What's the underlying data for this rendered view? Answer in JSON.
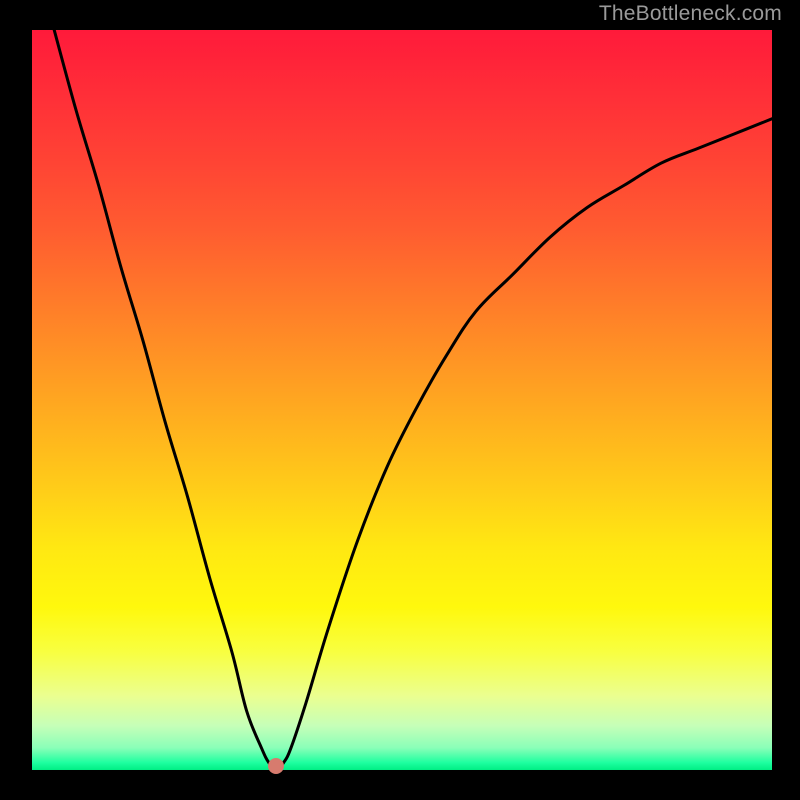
{
  "attribution": "TheBottleneck.com",
  "chart_data": {
    "type": "line",
    "title": "",
    "xlabel": "",
    "ylabel": "",
    "xlim": [
      0,
      100
    ],
    "ylim": [
      0,
      100
    ],
    "grid": false,
    "legend": false,
    "background": "gradient-red-to-green-vertical",
    "series": [
      {
        "name": "bottleneck-curve",
        "color": "#000000",
        "x": [
          3,
          6,
          9,
          12,
          15,
          18,
          21,
          24,
          27,
          29,
          31,
          32,
          33,
          34,
          35,
          37,
          40,
          44,
          48,
          52,
          56,
          60,
          65,
          70,
          75,
          80,
          85,
          90,
          95,
          100
        ],
        "y": [
          100,
          89,
          79,
          68,
          58,
          47,
          37,
          26,
          16,
          8,
          3,
          1,
          0,
          1,
          3,
          9,
          19,
          31,
          41,
          49,
          56,
          62,
          67,
          72,
          76,
          79,
          82,
          84,
          86,
          88
        ]
      }
    ],
    "marker": {
      "name": "optimal-point",
      "x": 33,
      "y": 0.5,
      "color": "#d77b6e"
    }
  }
}
